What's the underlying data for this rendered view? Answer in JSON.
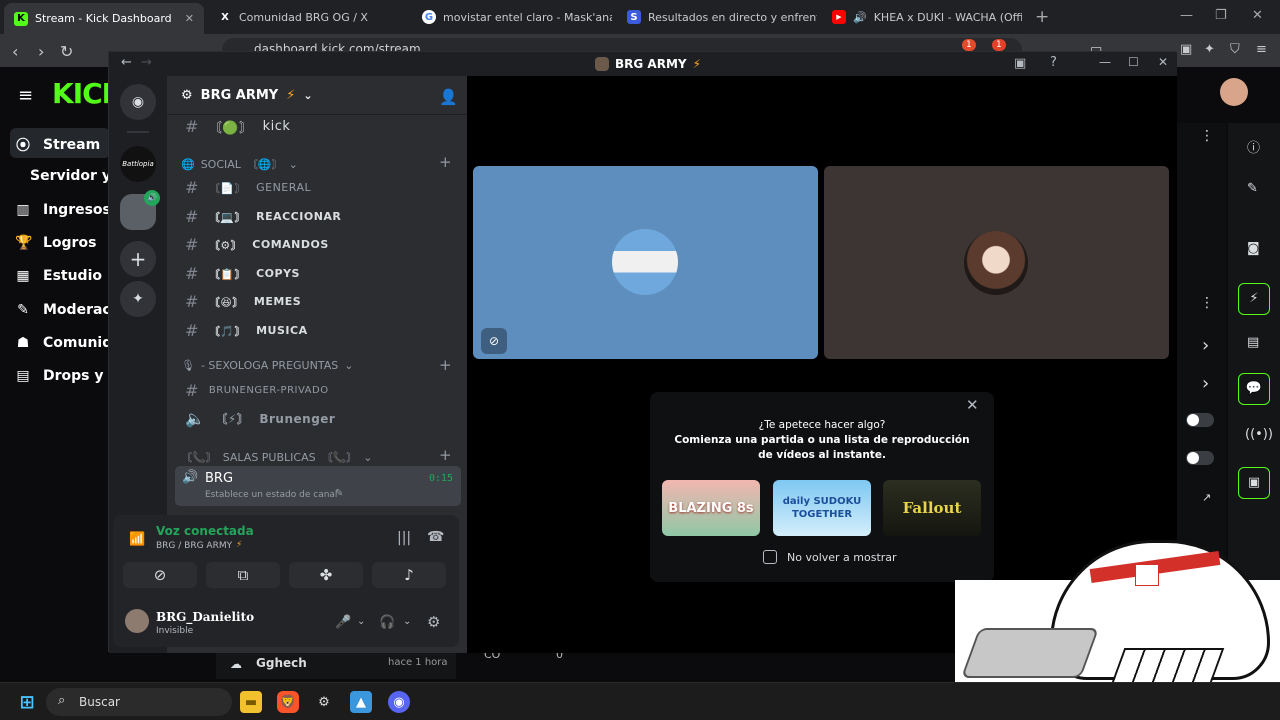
{
  "browser": {
    "tabs": [
      {
        "title": "Stream - Kick Dashboard",
        "favicon": "K"
      },
      {
        "title": "Comunidad BRG OG / X",
        "favicon": "X"
      },
      {
        "title": "movistar entel claro - Mask'ana Goog",
        "favicon": "G"
      },
      {
        "title": "Resultados en directo y enfrentamien",
        "favicon": "S"
      },
      {
        "title": "KHEA x DUKI - WACHA (Official V",
        "favicon": "▶"
      }
    ],
    "url": "dashboard.kick.com/stream",
    "badge_count": "1"
  },
  "kick": {
    "nav": [
      {
        "label": "Stream",
        "icon": "broadcast-icon"
      },
      {
        "label": "Servidor y c",
        "icon": ""
      },
      {
        "label": "Ingresos",
        "icon": "revenue-icon"
      },
      {
        "label": "Logros",
        "icon": "trophy-icon"
      },
      {
        "label": "Estudio",
        "icon": "studio-icon"
      },
      {
        "label": "Moderaci",
        "icon": "shield-icon"
      },
      {
        "label": "Comunid",
        "icon": "people-icon"
      },
      {
        "label": "Drops y re",
        "icon": "gift-icon"
      }
    ],
    "chat_user": "Gghech",
    "chat_time": "hace 1 hora",
    "stat_a": "CO",
    "stat_b": "0"
  },
  "discord": {
    "window_title": "BRG ARMY",
    "server_name": "BRG ARMY",
    "top_channel": "kick",
    "categories": {
      "social": "SOCIAL",
      "sexologa": "- SEXOLOGA PREGUNTAS",
      "salas": "SALAS PUBLICAS"
    },
    "channels": [
      "GENERAL",
      "REACCIONAR",
      "COMANDOS",
      "COPYS",
      "MEMES",
      "MUSICA"
    ],
    "private_channel": "BRUNENGER-PRIVADO",
    "voice_channel_locked": "Brunenger",
    "active_voice": {
      "name": "BRG",
      "time": "0:15",
      "status": "Establece un estado de canal"
    },
    "voice": {
      "status": "Voz conectada",
      "location": "BRG / BRG ARMY"
    },
    "user": {
      "name": "BRG_Danielito",
      "status": "Invisible"
    },
    "activity": {
      "title": "¿Te apetece hacer algo?",
      "subtitle": "Comienza una partida o una lista de reproducción de vídeos al instante.",
      "games": [
        "BLAZING 8s",
        "daily SUDOKU TOGETHER",
        "Fallout"
      ],
      "checkbox": "No volver a mostrar"
    },
    "guild_label": "Battlopia"
  },
  "taskbar": {
    "search": "Buscar"
  },
  "colors": {
    "kick_green": "#53fc18",
    "discord_blurple": "#5865f2",
    "voice_green": "#23a55a"
  }
}
